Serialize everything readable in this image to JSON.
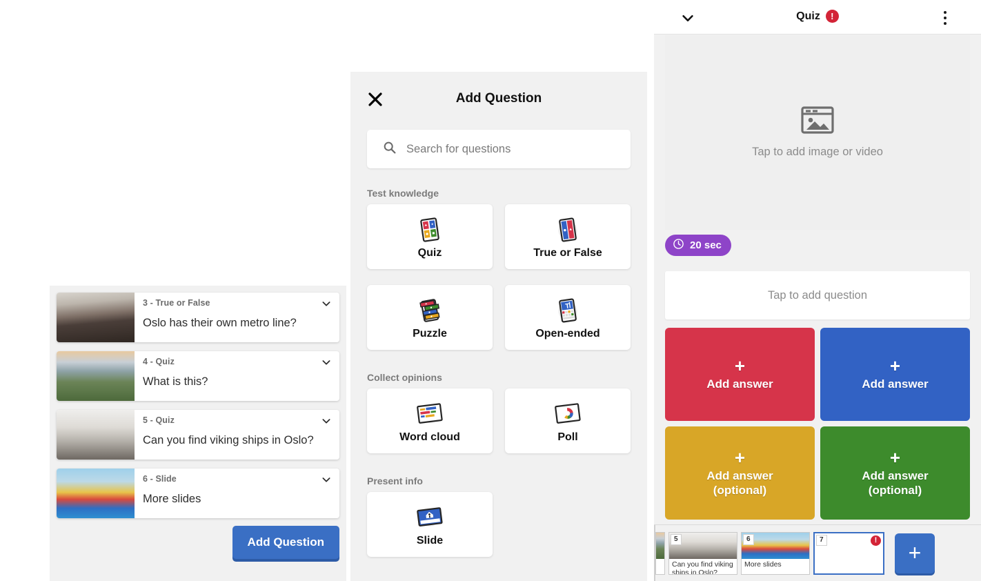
{
  "left_panel": {
    "questions": [
      {
        "meta": "3 - True or False",
        "title": "Oslo has their own metro line?",
        "thumb": "metro-station"
      },
      {
        "meta": "4 - Quiz",
        "title": "What is this?",
        "thumb": "oslo-overview"
      },
      {
        "meta": "5 - Quiz",
        "title": "Can you find viking ships in Oslo?",
        "thumb": "viking-ship"
      },
      {
        "meta": "6 - Slide",
        "title": "More slides",
        "thumb": "water-slides"
      }
    ],
    "add_question_label": "Add Question"
  },
  "modal": {
    "title": "Add Question",
    "close_icon": "close-icon",
    "search": {
      "placeholder": "Search for questions",
      "value": "",
      "icon": "search-icon"
    },
    "sections": [
      {
        "label": "Test knowledge",
        "rows": [
          [
            {
              "label": "Quiz",
              "icon": "quiz-icon"
            },
            {
              "label": "True or False",
              "icon": "true-false-icon"
            }
          ],
          [
            {
              "label": "Puzzle",
              "icon": "puzzle-icon"
            },
            {
              "label": "Open-ended",
              "icon": "open-ended-icon"
            }
          ]
        ]
      },
      {
        "label": "Collect opinions",
        "rows": [
          [
            {
              "label": "Word cloud",
              "icon": "word-cloud-icon"
            },
            {
              "label": "Poll",
              "icon": "poll-icon"
            }
          ]
        ]
      },
      {
        "label": "Present info",
        "rows": [
          [
            {
              "label": "Slide",
              "icon": "slide-icon"
            }
          ]
        ]
      }
    ]
  },
  "editor": {
    "header": {
      "collapse_icon": "chevron-down-icon",
      "title": "Quiz",
      "warning_badge": "!",
      "menu_icon": "kebab-menu-icon"
    },
    "media_placeholder": "Tap to add image or video",
    "media_icon": "image-placeholder-icon",
    "timer": {
      "label": "20 sec",
      "icon": "clock-icon"
    },
    "question_placeholder": "Tap to add question",
    "answers": [
      {
        "plus": "+",
        "label": "Add answer",
        "color": "#d6344a"
      },
      {
        "plus": "+",
        "label": "Add answer",
        "color": "#3262c4"
      },
      {
        "plus": "+",
        "label": "Add answer\n(optional)",
        "color": "#d8a627"
      },
      {
        "plus": "+",
        "label": "Add answer\n(optional)",
        "color": "#3d8b2c"
      }
    ]
  },
  "filmstrip": {
    "slides": [
      {
        "number": "",
        "text": "",
        "partial": true,
        "selected": false,
        "warning": false,
        "thumb": "oslo-overview"
      },
      {
        "number": "5",
        "text": "Can you find viking ships in Oslo?",
        "partial": false,
        "selected": false,
        "warning": false,
        "thumb": "viking-ship"
      },
      {
        "number": "6",
        "text": "More slides",
        "partial": false,
        "selected": false,
        "warning": false,
        "thumb": "water-slides"
      },
      {
        "number": "7",
        "text": "",
        "partial": false,
        "selected": true,
        "warning": true,
        "thumb": ""
      }
    ],
    "add_slide_label": "+"
  },
  "colors": {
    "brand_blue": "#3a6fc4",
    "warning_red": "#d32437",
    "timer_purple": "#8e44c8",
    "panel_gray": "#f1f1f1"
  }
}
